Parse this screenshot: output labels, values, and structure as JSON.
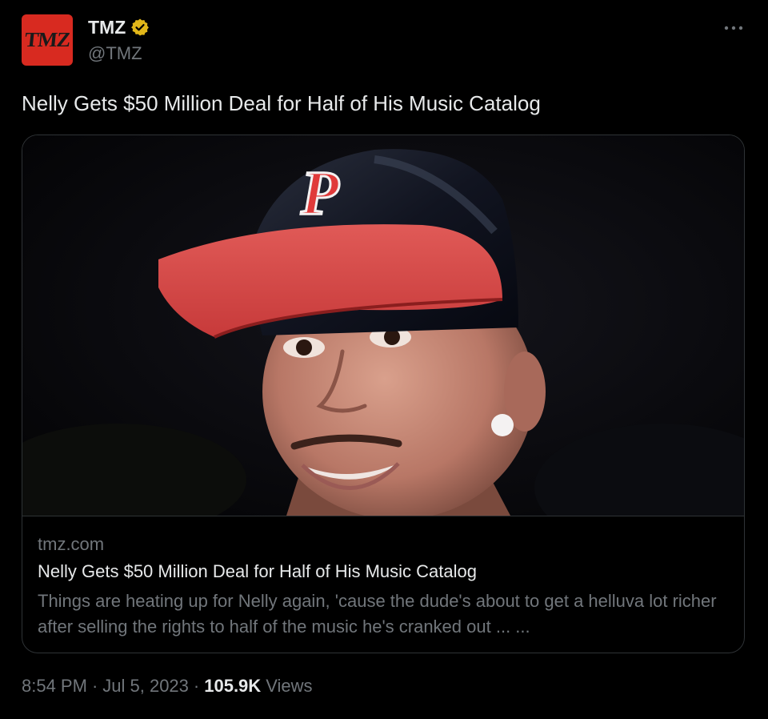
{
  "author": {
    "avatar_text": "TMZ",
    "display_name": "TMZ",
    "handle": "@TMZ",
    "verified_icon": "verified-gold-badge",
    "avatar_color": "#d82a20",
    "verified_color": "#e2b719"
  },
  "tweet": {
    "text": "Nelly Gets $50 Million Deal for Half of His Music Catalog"
  },
  "card": {
    "domain": "tmz.com",
    "title": "Nelly Gets $50 Million Deal for Half of His Music Catalog",
    "description": "Things are heating up for Nelly again, 'cause the dude's about to get a helluva lot richer after selling the rights to half of the music he's cranked out ... ..."
  },
  "meta": {
    "time": "8:54 PM",
    "separator": "·",
    "date": "Jul 5, 2023",
    "views_count": "105.9K",
    "views_label": "Views"
  },
  "icons": {
    "more": "more-horizontal-icon"
  }
}
